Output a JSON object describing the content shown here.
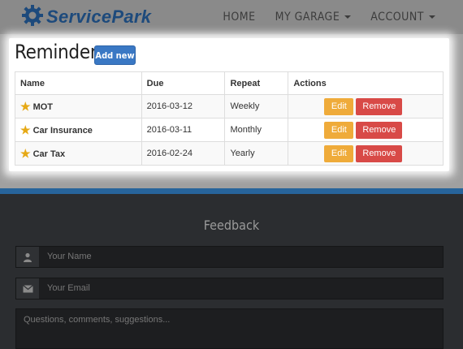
{
  "navbar": {
    "brand": "ServicePark",
    "items": [
      {
        "label": "HOME",
        "dropdown": false
      },
      {
        "label": "MY GARAGE",
        "dropdown": true
      },
      {
        "label": "ACCOUNT",
        "dropdown": true
      }
    ]
  },
  "reminders": {
    "title": "Reminders",
    "add_label": "Add new",
    "columns": [
      "Name",
      "Due",
      "Repeat",
      "Actions"
    ],
    "rows": [
      {
        "name": "MOT",
        "due": "2016-03-12",
        "repeat": "Weekly"
      },
      {
        "name": "Car Insurance",
        "due": "2016-03-11",
        "repeat": "Monthly"
      },
      {
        "name": "Car Tax",
        "due": "2016-02-24",
        "repeat": "Yearly"
      }
    ],
    "edit_label": "Edit",
    "remove_label": "Remove"
  },
  "feedback": {
    "title": "Feedback",
    "name_placeholder": "Your Name",
    "email_placeholder": "Your Email",
    "message_placeholder": "Questions, comments, suggestions..."
  },
  "icons": {
    "brand": "gear-icon",
    "row": "star-icon",
    "name_field": "user-icon",
    "email_field": "envelope-icon"
  },
  "colors": {
    "brand": "#1d4a7c",
    "primary": "#3a78c4",
    "warning": "#efab3a",
    "danger": "#d84a47",
    "accent_line": "#27649b"
  }
}
